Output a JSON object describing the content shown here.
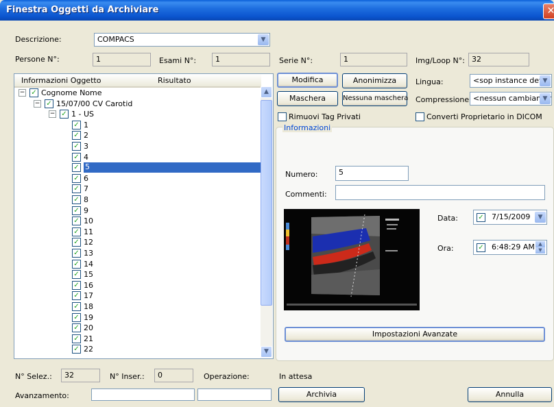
{
  "window": {
    "title": "Finestra Oggetti da Archiviare",
    "close_glyph": "✕"
  },
  "descrizione": {
    "label": "Descrizione:",
    "value": "COMPACS"
  },
  "counts": {
    "persone_label": "Persone N°:",
    "persone_value": "1",
    "esami_label": "Esami N°:",
    "esami_value": "1",
    "serie_label": "Serie N°:",
    "serie_value": "1",
    "img_label": "Img/Loop N°:",
    "img_value": "32"
  },
  "tree": {
    "col_oggetto": "Informazioni Oggetto",
    "col_risultato": "Risultato",
    "root": "Cognome Nome",
    "exam": "15/07/00 CV Carotid",
    "series": "1 - US",
    "items": [
      "1",
      "2",
      "3",
      "4",
      "5",
      "6",
      "7",
      "8",
      "9",
      "10",
      "11",
      "12",
      "13",
      "14",
      "15",
      "16",
      "17",
      "18",
      "19",
      "20",
      "21",
      "22"
    ],
    "selected": "5"
  },
  "buttons": {
    "modifica": "Modifica",
    "anonimizza": "Anonimizza",
    "maschera": "Maschera",
    "nessuna_maschera": "Nessuna maschera",
    "impostazioni": "Impostazioni Avanzate",
    "archivia": "Archivia",
    "annulla": "Annulla"
  },
  "options": {
    "lingua_label": "Lingua:",
    "lingua_value": "<sop instance defaul",
    "compressione_label": "Compressione:",
    "compressione_value": "<nessun cambiamen",
    "rimuovi_tag": "Rimuovi Tag Privati",
    "converti": "Converti Proprietario in DICOM"
  },
  "informazioni": {
    "title": "Informazioni",
    "numero_label": "Numero:",
    "numero_value": "5",
    "commenti_label": "Commenti:",
    "commenti_value": "",
    "data_label": "Data:",
    "data_value": "7/15/2009",
    "ora_label": "Ora:",
    "ora_value": "6:48:29 AM"
  },
  "footer": {
    "selez_label": "N° Selez.:",
    "selez_value": "32",
    "inser_label": "N° Inser.:",
    "inser_value": "0",
    "operazione_label": "Operazione:",
    "operazione_value": "In attesa",
    "avanzamento_label": "Avanzamento:"
  },
  "colors": {
    "title_blue": "#0b55cf",
    "selection": "#316ac5",
    "group_title": "#0046d5",
    "check_green": "#21a121"
  }
}
